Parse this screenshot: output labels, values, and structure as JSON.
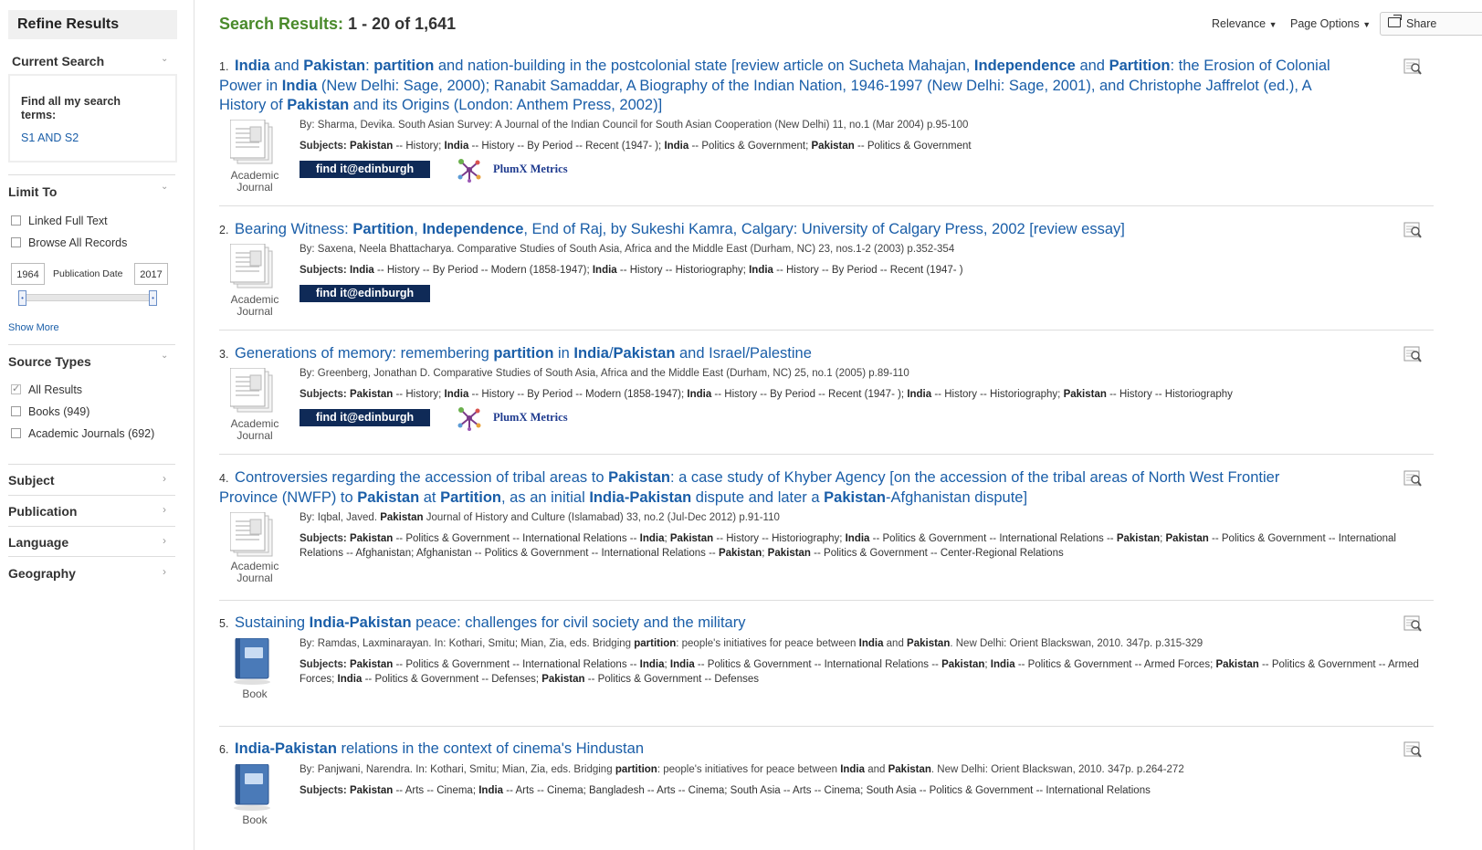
{
  "sidebar": {
    "refine_title": "Refine Results",
    "current_search": {
      "title": "Current Search",
      "label": "Find all my search terms:",
      "terms": "S1 AND S2"
    },
    "limit_to": {
      "title": "Limit To",
      "options": [
        {
          "label": "Linked Full Text",
          "checked": false
        },
        {
          "label": "Browse All Records",
          "checked": false
        }
      ],
      "date_from": "1964",
      "date_label": "Publication Date",
      "date_to": "2017",
      "show_more": "Show More"
    },
    "source_types": {
      "title": "Source Types",
      "options": [
        {
          "label": "All Results",
          "checked": true
        },
        {
          "label": "Books (949)",
          "checked": false
        },
        {
          "label": "Academic Journals (692)",
          "checked": false
        }
      ]
    },
    "facets": [
      "Subject",
      "Publication",
      "Language",
      "Geography"
    ]
  },
  "header": {
    "results_label": "Search Results:",
    "results_range": "1 - 20 of 1,641",
    "sort": "Relevance",
    "page_options": "Page Options",
    "share": "Share"
  },
  "results": [
    {
      "number": "1.",
      "title_html": "<b>India</b> and <b>Pakistan</b>: <b>partition</b> and nation-building in the postcolonial state [review article on Sucheta Mahajan, <b>Independence</b> and <b>Partition</b>: the Erosion of Colonial Power in <b>India</b> (New Delhi: Sage, 2000); Ranabit Samaddar, A Biography of the Indian Nation, 1946-1997 (New Delhi: Sage, 2001), and Christophe Jaffrelot (ed.), A History of <b>Pakistan</b> and its Origins (London: Anthem Press, 2002)]",
      "by_html": "By: Sharma, Devika. South Asian Survey: A Journal of the Indian Council for South Asian Cooperation (New Delhi) 11, no.1 (Mar 2004) p.95-100",
      "subjects_html": "<b>Pakistan</b> -- History; <b>India</b> -- History -- By Period -- Recent (1947- ); <b>India</b> -- Politics &amp; Government; <b>Pakistan</b> -- Politics &amp; Government",
      "type": "Academic Journal",
      "findit": "find it@edinburgh",
      "plumx": "PlumX Metrics"
    },
    {
      "number": "2.",
      "title_html": "Bearing Witness: <b>Partition</b>, <b>Independence</b>, End of Raj, by Sukeshi Kamra, Calgary: University of Calgary Press, 2002 [review essay]",
      "by_html": "By: Saxena, Neela Bhattacharya. Comparative Studies of South Asia, Africa and the Middle East (Durham, NC) 23, nos.1-2 (2003) p.352-354",
      "subjects_html": "<b>India</b> -- History -- By Period -- Modern (1858-1947); <b>India</b> -- History -- Historiography; <b>India</b> -- History -- By Period -- Recent (1947- )",
      "type": "Academic Journal",
      "findit": "find it@edinburgh",
      "plumx": ""
    },
    {
      "number": "3.",
      "title_html": "Generations of memory: remembering <b>partition</b> in <b>India</b>/<b>Pakistan</b> and Israel/Palestine",
      "by_html": "By: Greenberg, Jonathan D. Comparative Studies of South Asia, Africa and the Middle East (Durham, NC) 25, no.1 (2005) p.89-110",
      "subjects_html": "<b>Pakistan</b> -- History; <b>India</b> -- History -- By Period -- Modern (1858-1947); <b>India</b> -- History -- By Period -- Recent (1947- ); <b>India</b> -- History -- Historiography; <b>Pakistan</b> -- History -- Historiography",
      "type": "Academic Journal",
      "findit": "find it@edinburgh",
      "plumx": "PlumX Metrics"
    },
    {
      "number": "4.",
      "title_html": "Controversies regarding the accession of tribal areas to <b>Pakistan</b>: a case study of Khyber Agency [on the accession of the tribal areas of North West Frontier Province (NWFP) to <b>Pakistan</b> at <b>Partition</b>, as an initial <b>India-Pakistan</b> dispute and later a <b>Pakistan</b>-Afghanistan dispute]",
      "by_html": "By: Iqbal, Javed. <b>Pakistan</b> Journal of History and Culture (Islamabad) 33, no.2 (Jul-Dec 2012) p.91-110",
      "subjects_html": "<b>Pakistan</b> -- Politics &amp; Government -- International Relations -- <b>India</b>; <b>Pakistan</b> -- History -- Historiography; <b>India</b> -- Politics &amp; Government -- International Relations -- <b>Pakistan</b>; <b>Pakistan</b> -- Politics &amp; Government -- International Relations -- Afghanistan; Afghanistan -- Politics &amp; Government -- International Relations -- <b>Pakistan</b>; <b>Pakistan</b> -- Politics &amp; Government -- Center-Regional Relations",
      "type": "Academic Journal",
      "findit": "",
      "plumx": ""
    },
    {
      "number": "5.",
      "title_html": "Sustaining <b>India-Pakistan</b> peace: challenges for civil society and the military",
      "by_html": "By: Ramdas, Laxminarayan. In: Kothari, Smitu; Mian, Zia, eds. Bridging <b>partition</b>: people's initiatives for peace between <b>India</b> and <b>Pakistan</b>. New Delhi: Orient Blackswan, 2010. 347p. p.315-329",
      "subjects_html": "<b>Pakistan</b> -- Politics &amp; Government -- International Relations -- <b>India</b>; <b>India</b> -- Politics &amp; Government -- International Relations -- <b>Pakistan</b>; <b>India</b> -- Politics &amp; Government -- Armed Forces; <b>Pakistan</b> -- Politics &amp; Government -- Armed Forces; <b>India</b> -- Politics &amp; Government -- Defenses; <b>Pakistan</b> -- Politics &amp; Government -- Defenses",
      "type": "Book",
      "findit": "",
      "plumx": ""
    },
    {
      "number": "6.",
      "title_html": "<b>India-Pakistan</b> relations in the context of cinema's Hindustan",
      "by_html": "By: Panjwani, Narendra. In: Kothari, Smitu; Mian, Zia, eds. Bridging <b>partition</b>: people's initiatives for peace between <b>India</b> and <b>Pakistan</b>. New Delhi: Orient Blackswan, 2010. 347p. p.264-272",
      "subjects_html": "<b>Pakistan</b> -- Arts -- Cinema; <b>India</b> -- Arts -- Cinema; Bangladesh -- Arts -- Cinema; South Asia -- Arts -- Cinema; South Asia -- Politics &amp; Government -- International Relations",
      "type": "Book",
      "findit": "",
      "plumx": ""
    }
  ],
  "subjects_label": "Subjects:",
  "colors": {
    "link": "#1a5ea8",
    "results_green": "#4a8a2b",
    "findit_bg": "#0f2a57"
  }
}
